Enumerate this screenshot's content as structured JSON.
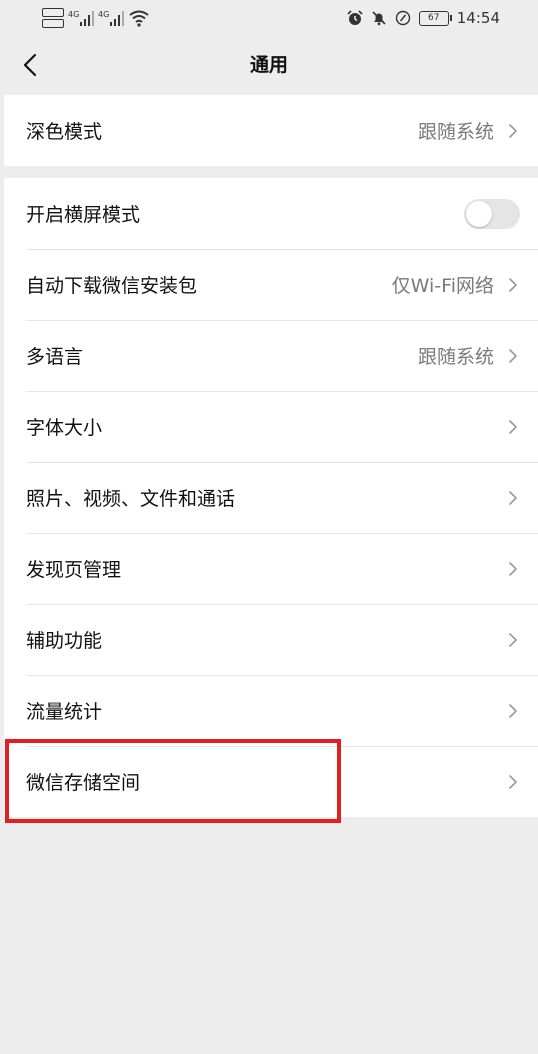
{
  "status_bar": {
    "time": "14:54",
    "battery_level": "67",
    "left_icons": [
      "sim-card-icon",
      "signal-icon",
      "signal-icon",
      "wifi-icon"
    ],
    "right_icons": [
      "alarm-icon",
      "mute-bell-icon",
      "speed-icon",
      "battery-icon"
    ]
  },
  "nav": {
    "title": "通用",
    "back_icon": "chevron-left-icon"
  },
  "groups": [
    {
      "items": [
        {
          "label": "深色模式",
          "value": "跟随系统",
          "control": "chevron"
        }
      ]
    },
    {
      "items": [
        {
          "label": "开启横屏模式",
          "value": "",
          "control": "toggle",
          "toggle_on": false
        },
        {
          "label": "自动下载微信安装包",
          "value": "仅Wi-Fi网络",
          "control": "chevron"
        },
        {
          "label": "多语言",
          "value": "跟随系统",
          "control": "chevron"
        },
        {
          "label": "字体大小",
          "value": "",
          "control": "chevron"
        },
        {
          "label": "照片、视频、文件和通话",
          "value": "",
          "control": "chevron"
        },
        {
          "label": "发现页管理",
          "value": "",
          "control": "chevron"
        },
        {
          "label": "辅助功能",
          "value": "",
          "control": "chevron"
        },
        {
          "label": "流量统计",
          "value": "",
          "control": "chevron"
        },
        {
          "label": "微信存储空间",
          "value": "",
          "control": "chevron"
        }
      ]
    }
  ],
  "highlight": {
    "color": "#e02020",
    "target": "微信存储空间"
  },
  "colors": {
    "background": "#ededed",
    "card": "#ffffff",
    "secondary_text": "#7a7a7a"
  }
}
